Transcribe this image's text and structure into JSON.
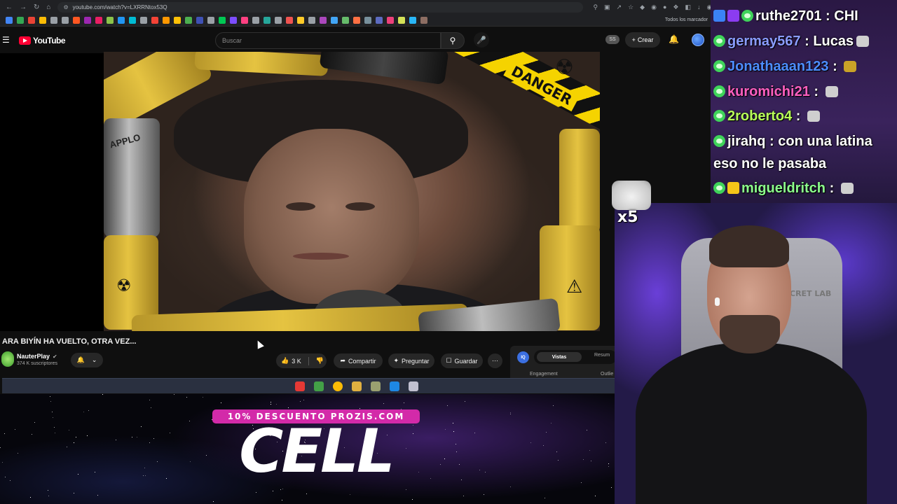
{
  "browser": {
    "url": "youtube.com/watch?v=LXRRNtox53Q",
    "all_bookmarks_label": "Todos los marcador",
    "bookmark_colors": [
      "#4285f4",
      "#34a853",
      "#ea4335",
      "#fbbc05",
      "#9aa0a6",
      "#9aa0a6",
      "#ff5722",
      "#9c27b0",
      "#e91e63",
      "#8bc34a",
      "#2196f3",
      "#00bcd4",
      "#9aa0a6",
      "#f44336",
      "#ff9800",
      "#ffc107",
      "#4caf50",
      "#3f51b5",
      "#9aa0a6",
      "#00c853",
      "#7c4dff",
      "#ff4081",
      "#9aa0a6",
      "#26a69a",
      "#9aa0a6",
      "#ef5350",
      "#ffca28",
      "#9aa0a6",
      "#ab47bc",
      "#42a5f5",
      "#66bb6a",
      "#ff7043",
      "#78909c",
      "#5c6bc0",
      "#ec407a",
      "#d4e157",
      "#29b6f6",
      "#8d6e63"
    ]
  },
  "youtube": {
    "logo_text": "YouTube",
    "search_placeholder": "Buscar",
    "profile_badge": "SS",
    "create_label": "Crear"
  },
  "video": {
    "title": "ARA BIYÍN HA VUELTO, OTRA VEZ...",
    "danger_text": "DANGER",
    "barrel_text": "APPLO",
    "channel_name": "NauterPlay",
    "subscribers": "374 K suscriptores",
    "likes": "3 K",
    "share_label": "Compartir",
    "ask_label": "Preguntar",
    "save_label": "Guardar"
  },
  "panel": {
    "logo": "IQ",
    "tab_active": "Vistas",
    "tab_other": "Resum",
    "engagement_label": "Engagement",
    "outlier_label": "Outlie"
  },
  "taskbar": {
    "icon_colors": [
      "#e53935",
      "#43a047",
      "#fbbc05",
      "#e0b040",
      "#9aa070",
      "#1e88e5",
      "#c0c0d0"
    ]
  },
  "promo": {
    "badge": "10% DESCUENTO PROZIS.COM",
    "brand": "CELL"
  },
  "chat": {
    "messages": [
      {
        "user": "ruthe2701",
        "text": "CHI",
        "color": "#ffffff"
      },
      {
        "user": "germay567",
        "text": "Lucas",
        "color": "#8a9cff"
      },
      {
        "user": "Jonathaaan123",
        "text": "",
        "color": "#4d8dff"
      },
      {
        "user": "kuromichi21",
        "text": "",
        "color": "#ff5fc0"
      },
      {
        "user": "2roberto4",
        "text": "",
        "color": "#b8ff59"
      },
      {
        "user": "jirahq",
        "text": "con una latina",
        "color": "#ffffff"
      },
      {
        "user": "",
        "text": "eso no le pasaba",
        "color": "#ffffff"
      },
      {
        "user": "migueldritch",
        "text": "",
        "color": "#8cff8c"
      }
    ]
  },
  "overlay": {
    "emote_multiplier": "x5",
    "chair_text": "CRET LAB"
  }
}
